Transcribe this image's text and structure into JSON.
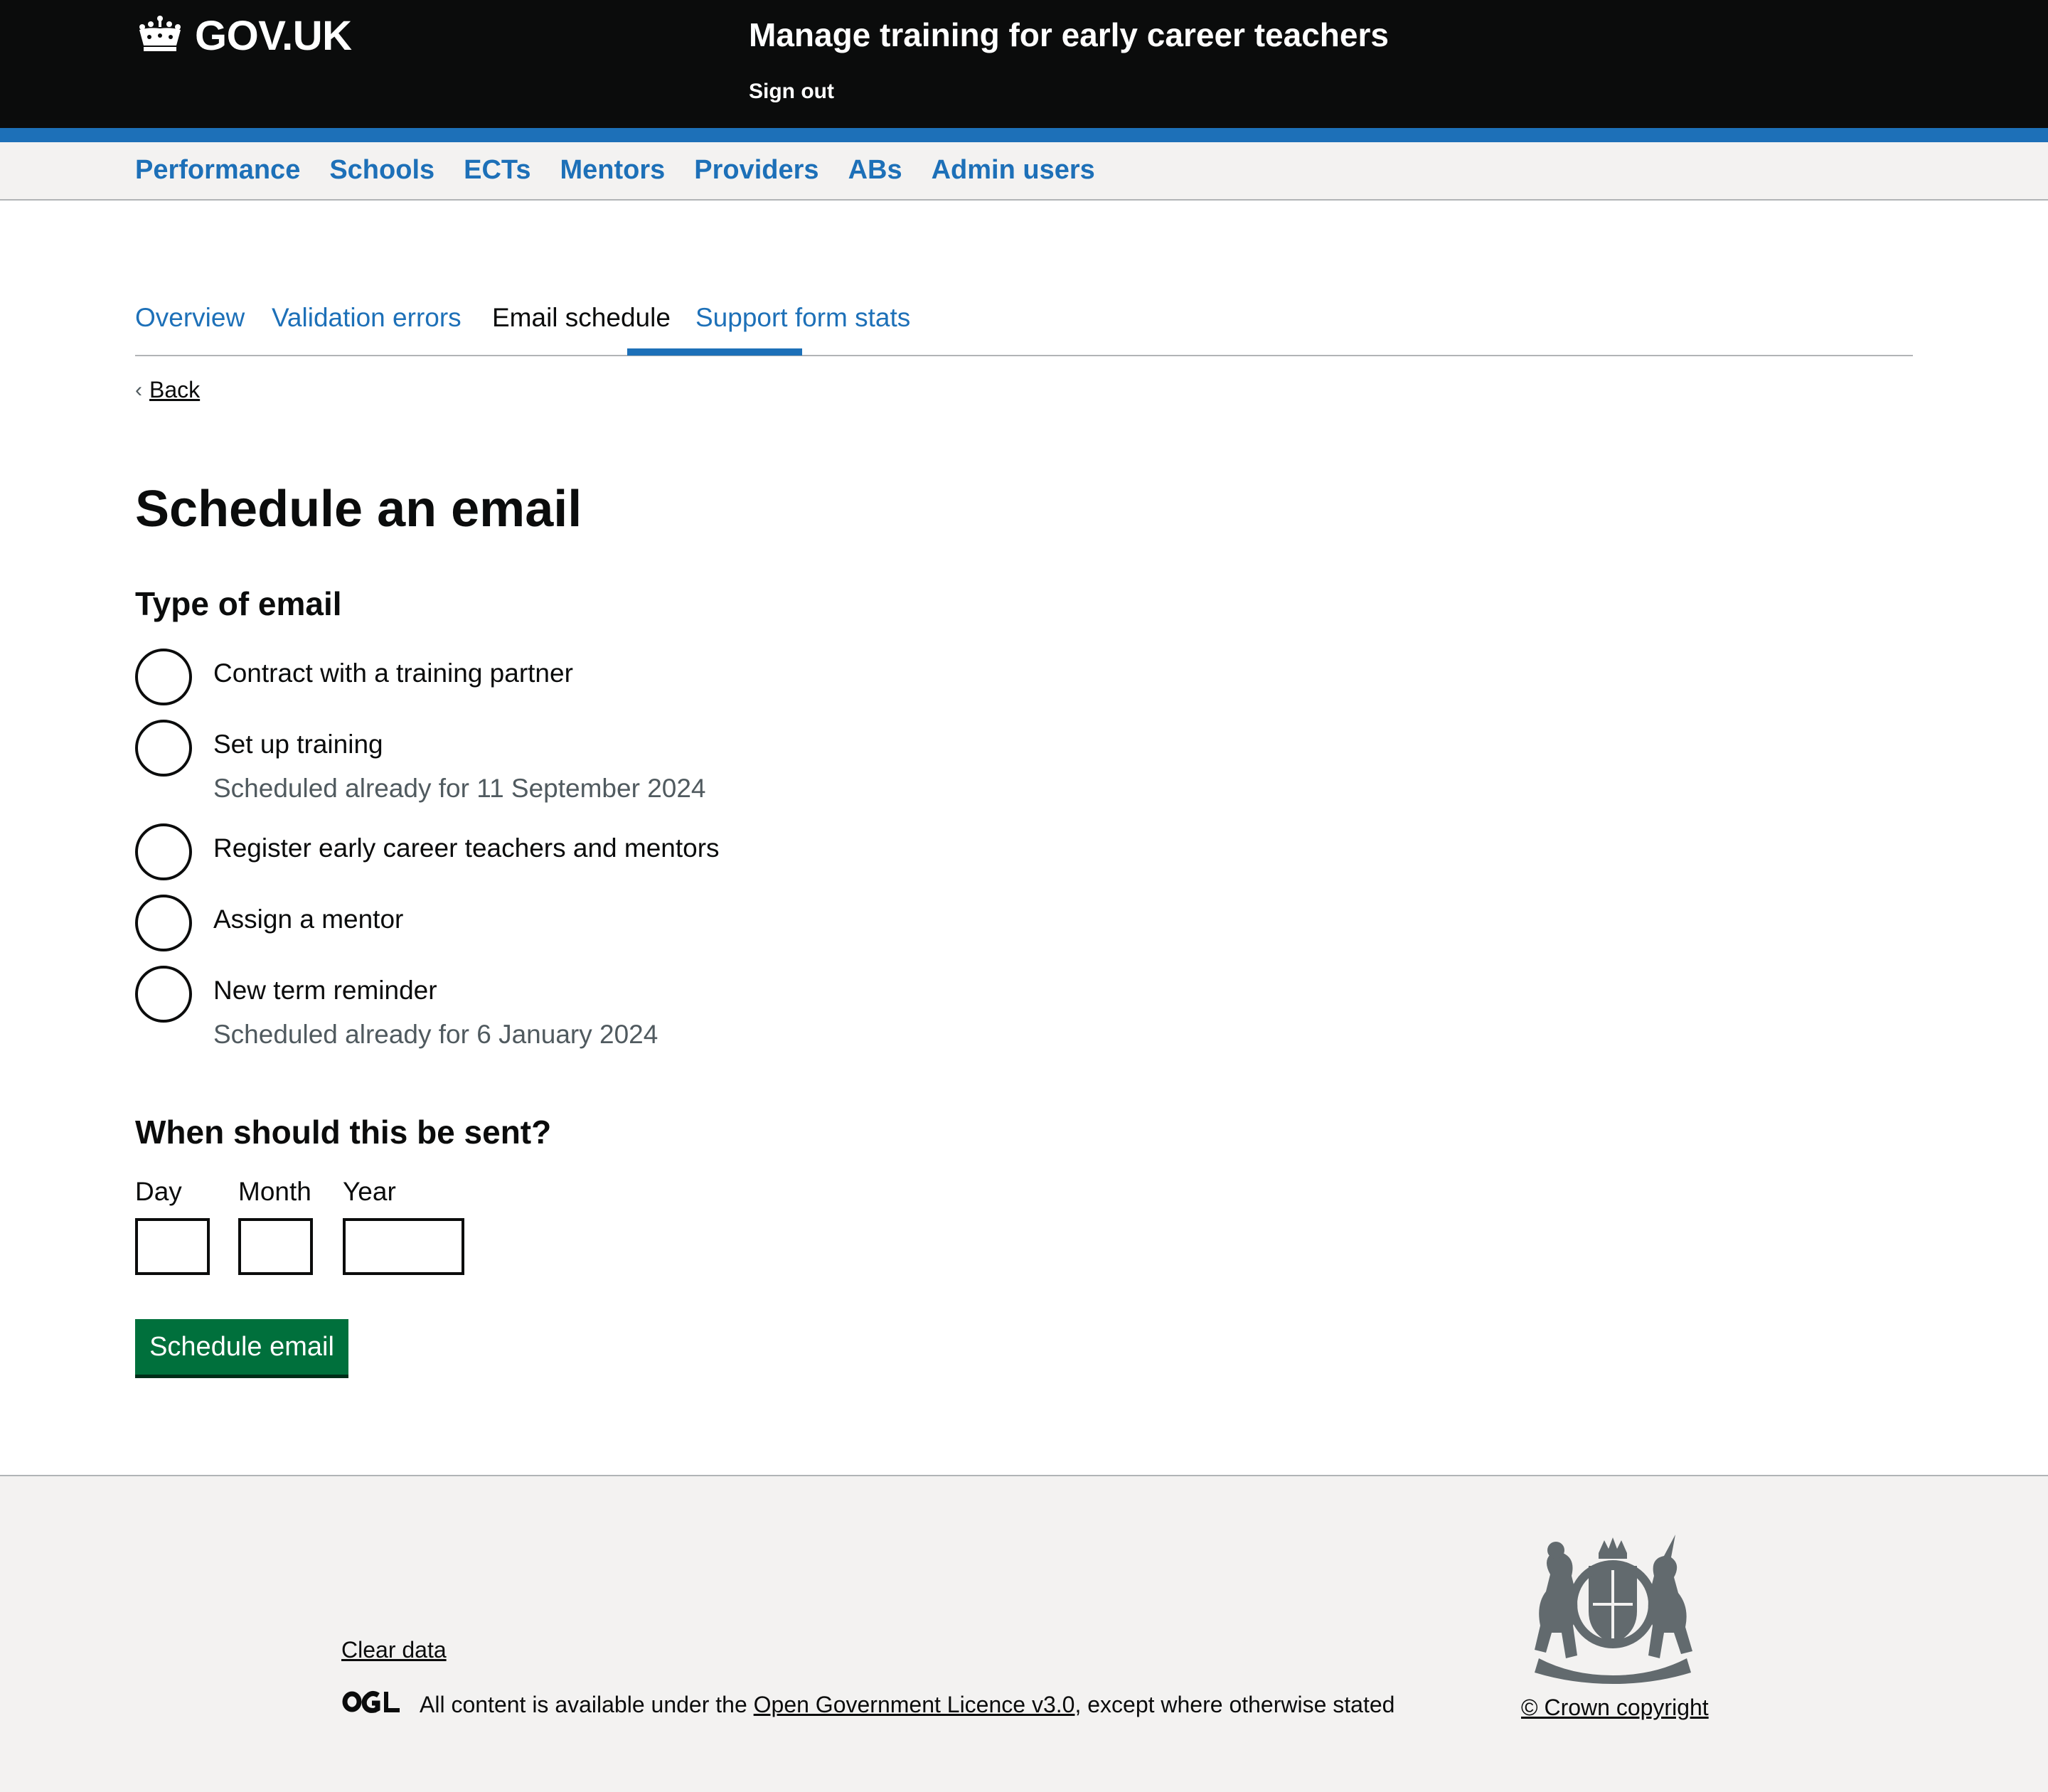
{
  "header": {
    "logo_text": "GOV.UK",
    "service_name": "Manage training for early career teachers",
    "sign_out": "Sign out"
  },
  "primary_nav": {
    "items": [
      {
        "label": "Performance"
      },
      {
        "label": "Schools"
      },
      {
        "label": "ECTs"
      },
      {
        "label": "Mentors"
      },
      {
        "label": "Providers"
      },
      {
        "label": "ABs"
      },
      {
        "label": "Admin users"
      }
    ]
  },
  "tabs": {
    "items": [
      {
        "label": "Overview",
        "active": false
      },
      {
        "label": "Validation errors",
        "active": false
      },
      {
        "label": "Email schedule",
        "active": true
      },
      {
        "label": "Support form stats",
        "active": false
      }
    ]
  },
  "back_link": "Back",
  "page_title": "Schedule an email",
  "email_type": {
    "legend": "Type of email",
    "options": [
      {
        "label": "Contract with a training partner",
        "hint": "",
        "selected": false
      },
      {
        "label": "Set up training",
        "hint": "Scheduled already for 11 September 2024",
        "selected": false
      },
      {
        "label": "Register early career teachers and mentors",
        "hint": "",
        "selected": false
      },
      {
        "label": "Assign a mentor",
        "hint": "",
        "selected": false
      },
      {
        "label": "New term reminder",
        "hint": "Scheduled already for 6 January 2024",
        "selected": false
      }
    ]
  },
  "send_date": {
    "legend": "When should this be sent?",
    "day_label": "Day",
    "month_label": "Month",
    "year_label": "Year",
    "day_value": "",
    "month_value": "",
    "year_value": ""
  },
  "submit_button": "Schedule email",
  "footer": {
    "clear_data": "Clear data",
    "licence_prefix": "All content is available under the ",
    "licence_link": "Open Government Licence v3.0",
    "licence_suffix": ", except where otherwise stated",
    "crown_copyright": "© Crown copyright"
  },
  "colors": {
    "header_bg": "#0b0c0c",
    "brand_blue": "#1d70b8",
    "button_green": "#00703c",
    "footer_bg": "#f3f2f1",
    "hint_grey": "#505a5f"
  }
}
